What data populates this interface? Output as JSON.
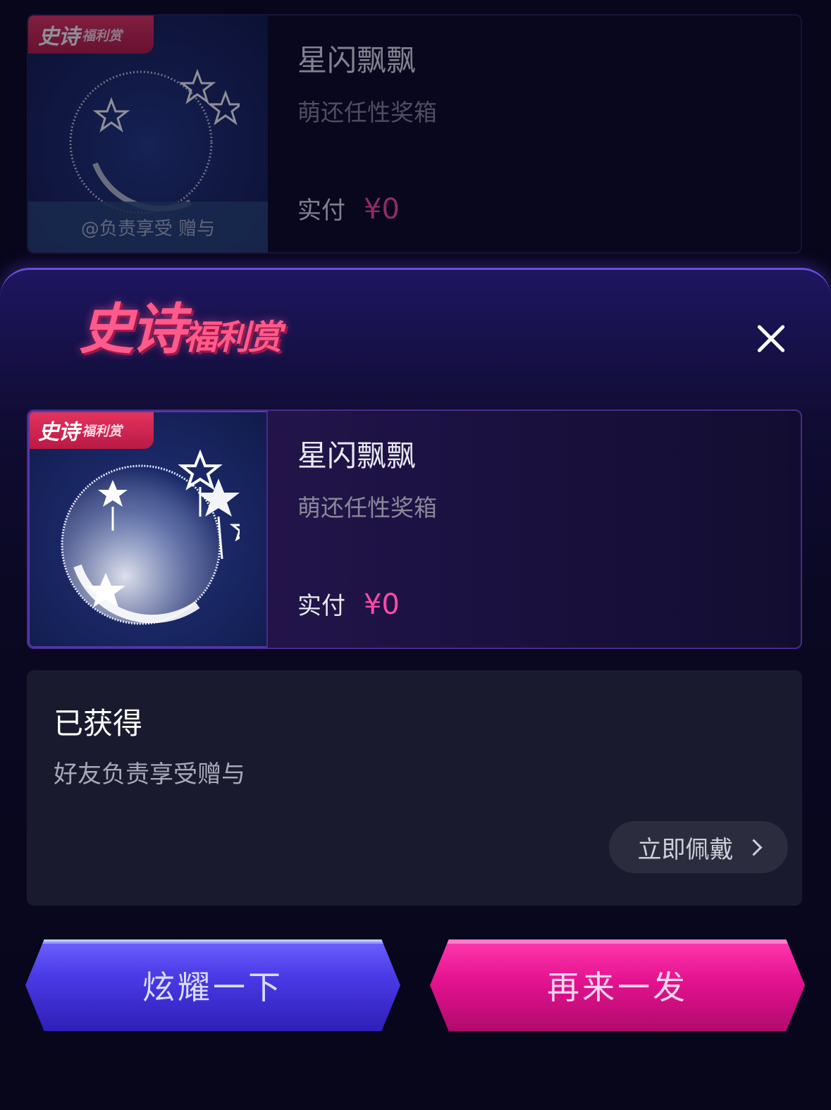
{
  "background_item": {
    "badge_big": "史诗",
    "badge_small": "福利赏",
    "gift_from": "@负责享受 赠与",
    "name": "星闪飘飘",
    "box": "萌还任性奖箱",
    "pay_label": "实付",
    "price": "¥0"
  },
  "modal": {
    "logo_big": "史诗",
    "logo_small": "福利赏",
    "item": {
      "badge_big": "史诗",
      "badge_small": "福利赏",
      "name": "星闪飘飘",
      "box": "萌还任性奖箱",
      "pay_label": "实付",
      "price": "¥0"
    },
    "obtained": {
      "title": "已获得",
      "desc": "好友负责享受赠与",
      "wear_label": "立即佩戴"
    },
    "buttons": {
      "show_off": "炫耀一下",
      "again": "再来一发"
    }
  },
  "colors": {
    "accent_pink": "#ff4aa8",
    "button_blue": "#4a3ae6",
    "button_pink": "#e4128f"
  }
}
